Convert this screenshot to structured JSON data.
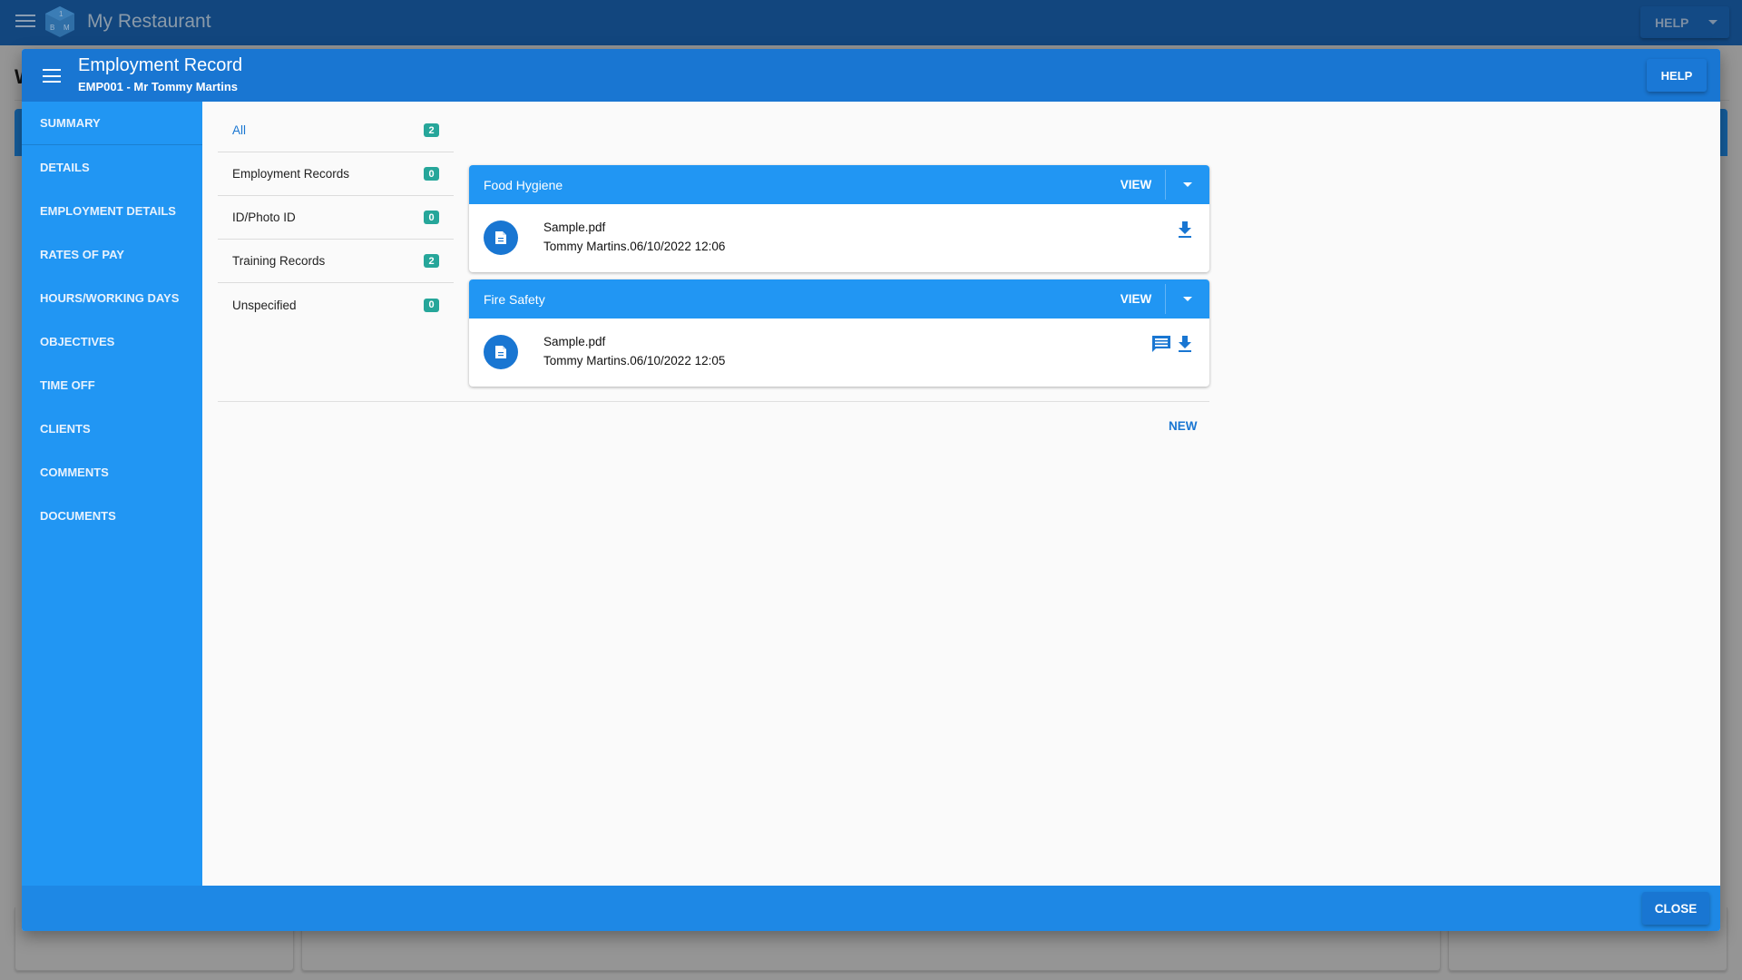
{
  "app": {
    "title": "My Restaurant",
    "help_label": "HELP",
    "background_heading_initial": "W"
  },
  "modal": {
    "title": "Employment Record",
    "subtitle": "EMP001 - Mr Tommy Martins",
    "help_label": "HELP",
    "close_label": "CLOSE"
  },
  "sidebar": {
    "items": [
      {
        "label": "SUMMARY"
      },
      {
        "label": "DETAILS"
      },
      {
        "label": "EMPLOYMENT DETAILS"
      },
      {
        "label": "RATES OF PAY"
      },
      {
        "label": "HOURS/WORKING DAYS"
      },
      {
        "label": "OBJECTIVES"
      },
      {
        "label": "TIME OFF"
      },
      {
        "label": "CLIENTS"
      },
      {
        "label": "COMMENTS"
      },
      {
        "label": "DOCUMENTS",
        "active": true
      }
    ]
  },
  "categories": [
    {
      "label": "All",
      "count": "2",
      "active": true
    },
    {
      "label": "Employment Records",
      "count": "0"
    },
    {
      "label": "ID/Photo ID",
      "count": "0"
    },
    {
      "label": "Training Records",
      "count": "2"
    },
    {
      "label": "Unspecified",
      "count": "0"
    }
  ],
  "documents": [
    {
      "title": "Food Hygiene",
      "view_label": "VIEW",
      "file_name": "Sample.pdf",
      "meta": "Tommy Martins.06/10/2022 12:06",
      "icons": [
        "download-icon"
      ]
    },
    {
      "title": "Fire Safety",
      "view_label": "VIEW",
      "file_name": "Sample.pdf",
      "meta": "Tommy Martins.06/10/2022 12:05",
      "icons": [
        "comment-icon",
        "download-icon"
      ]
    }
  ],
  "new_label": "NEW",
  "colors": {
    "primary": "#1976d2",
    "sidebar": "#2196f3",
    "footer": "#1e88e5",
    "badge": "#26a69a",
    "appbar_dimmed": "#12467e"
  }
}
